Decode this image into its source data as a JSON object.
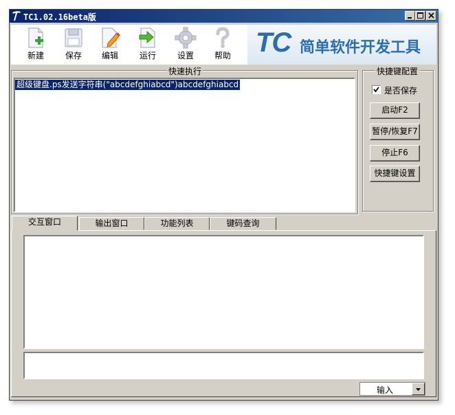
{
  "window": {
    "title": "TC1.02.16beta版"
  },
  "toolbar": {
    "items": [
      {
        "label": "新建",
        "icon": "new-file-icon"
      },
      {
        "label": "保存",
        "icon": "save-disk-icon"
      },
      {
        "label": "编辑",
        "icon": "edit-pencil-icon"
      },
      {
        "label": "运行",
        "icon": "run-arrow-icon"
      },
      {
        "label": "设置",
        "icon": "settings-gear-icon"
      },
      {
        "label": "帮助",
        "icon": "help-question-icon"
      }
    ],
    "banner": {
      "logo": "TC",
      "text": "简单软件开发工具"
    }
  },
  "quick_exec": {
    "title": "快速执行",
    "items": [
      "超级键盘.ps发送字符串(\"abcdefghiabcd\")abcdefghiabcd"
    ]
  },
  "hotkey_config": {
    "title": "快捷键配置",
    "save_label": "是否保存",
    "save_checked": true,
    "start_label": "启动F2",
    "pause_label": "暂停/恢复F7",
    "stop_label": "停止F6",
    "settings_label": "快捷键设置"
  },
  "tabs": [
    "交互窗口",
    "输出窗口",
    "功能列表",
    "键码查询"
  ],
  "input_mode": {
    "value": "输入"
  },
  "colors": {
    "titlebar": "#0a246a",
    "selection": "#0a246a",
    "banner_text": "#2a6eb0",
    "face": "#d4d0c8"
  }
}
